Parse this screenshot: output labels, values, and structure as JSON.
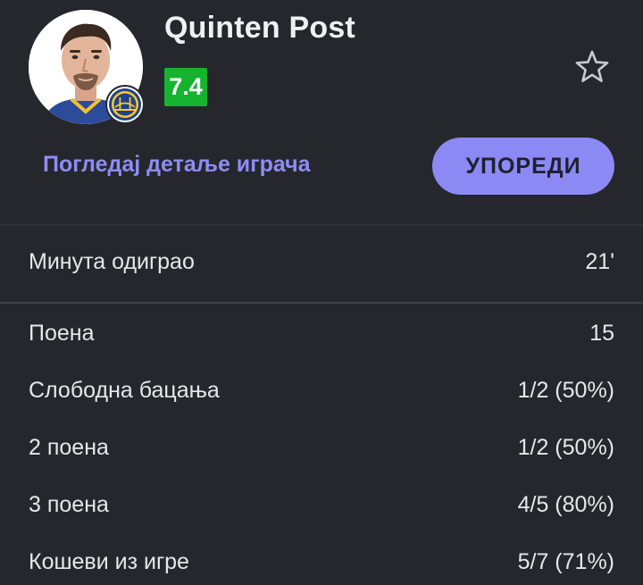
{
  "player": {
    "name": "Quinten Post",
    "rating": "7.4",
    "rating_color": "#16b32f",
    "team_badge_icon": "golden-state-warriors-logo"
  },
  "actions": {
    "details_link": "Погледај детаље играча",
    "compare_button": "УПОРЕДИ",
    "favorite_icon": "star-outline-icon"
  },
  "colors": {
    "accent": "#8b8af5",
    "background": "#25272c"
  },
  "stats": {
    "minutes": {
      "label": "Минута одиграо",
      "value": "21'"
    },
    "rows": [
      {
        "label": "Поена",
        "value": "15"
      },
      {
        "label": "Слободна бацања",
        "value": "1/2 (50%)"
      },
      {
        "label": "2 поена",
        "value": "1/2 (50%)"
      },
      {
        "label": "3 поена",
        "value": "4/5 (80%)"
      },
      {
        "label": "Кошеви из игре",
        "value": "5/7 (71%)"
      }
    ]
  }
}
